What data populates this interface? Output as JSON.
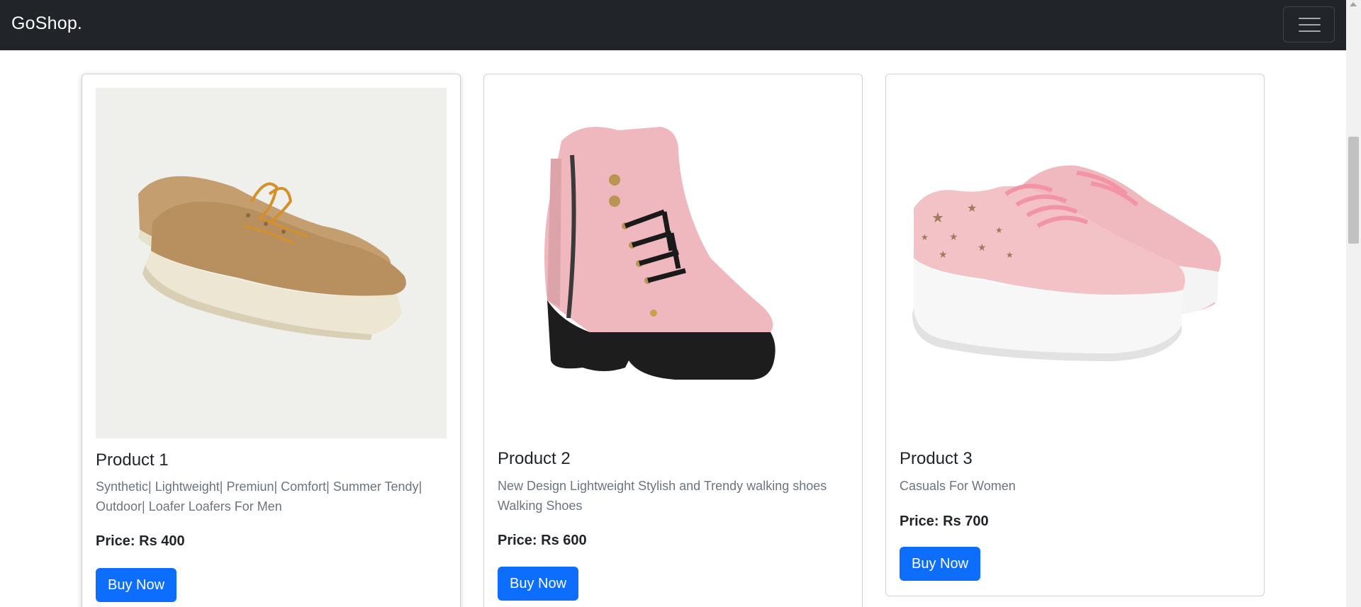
{
  "navbar": {
    "brand": "GoShop.",
    "toggler_icon": "hamburger-menu-icon",
    "background_color": "#212529"
  },
  "theme": {
    "primary_button_color": "#0d6efd",
    "muted_text_color": "#6c757d"
  },
  "products": [
    {
      "title": "Product 1",
      "description": "Synthetic| Lightweight| Premiun| Comfort| Summer Tendy| Outdoor| Loafer Loafers For Men",
      "price": "Price: Rs 400",
      "button_label": "Buy Now",
      "image": "tan-suede-boat-shoes"
    },
    {
      "title": "Product 2",
      "description": "New Design Lightweight Stylish and Trendy walking shoes Walking Shoes",
      "price": "Price: Rs 600",
      "button_label": "Buy Now",
      "image": "pink-block-heel-ankle-boot"
    },
    {
      "title": "Product 3",
      "description": "Casuals For Women",
      "price": "Price: Rs 700",
      "button_label": "Buy Now",
      "image": "pink-star-sneakers"
    }
  ]
}
